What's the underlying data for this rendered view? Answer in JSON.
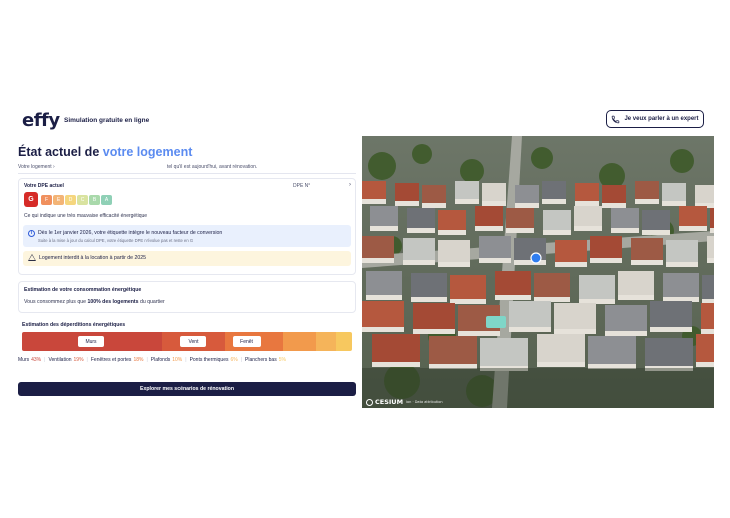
{
  "header": {
    "logo": "effy",
    "tagline": "Simulation gratuite en ligne",
    "expert_button": "Je veux parler à un expert"
  },
  "page": {
    "title_prefix": "État actuel de",
    "title_accent": "votre logement",
    "subtitle_left": "Votre logement ›",
    "subtitle_right": "tel qu'il est aujourd'hui, avant rénovation."
  },
  "dpe": {
    "label": "Votre DPE actuel",
    "dpe_no": "DPE N°",
    "chevron": "›",
    "letters": [
      {
        "letter": "G",
        "color": "#d62b27",
        "active": true
      },
      {
        "letter": "F",
        "color": "#f0905e"
      },
      {
        "letter": "E",
        "color": "#f3b476"
      },
      {
        "letter": "D",
        "color": "#f5d67e"
      },
      {
        "letter": "C",
        "color": "#d9e3a0"
      },
      {
        "letter": "B",
        "color": "#a9d9ab"
      },
      {
        "letter": "A",
        "color": "#8fd0b6"
      }
    ],
    "description": "Ce qui indique une très mauvaise efficacité énergétique",
    "info_title": "Dès le 1er janvier 2026, votre étiquette intègre le nouveau facteur de conversion",
    "info_text": "Suite à la mise à jour du calcul DPE, votre étiquette DPE n'évolue pas et reste en G",
    "info_icon": "info-icon",
    "warning_text": "Logement interdit à la location à partir de 2025",
    "warning_icon": "warning-icon"
  },
  "conso": {
    "label": "Estimation de votre consommation énergétique",
    "text_before": "Vous consommez plus que",
    "text_bold": "100% des logements",
    "text_after": "du quartier"
  },
  "deperditions": {
    "label": "Estimation des déperditions énergétiques",
    "segments": [
      {
        "name": "Murs",
        "percent": 43,
        "color": "#c9473b",
        "tag": "Murs"
      },
      {
        "name": "Ventilation",
        "percent": 19,
        "color": "#d75a3c",
        "tag": "Vent"
      },
      {
        "name": "Fenêtres et portes",
        "percent": 18,
        "color": "#e8773f",
        "tag": "Fenêt"
      },
      {
        "name": "Plafonds",
        "percent": 10,
        "color": "#f29a4c",
        "tag": ""
      },
      {
        "name": "Ponts thermiques",
        "percent": 6,
        "color": "#f5b45a",
        "tag": ""
      },
      {
        "name": "Planchers bas",
        "percent": 5,
        "color": "#f7c85f",
        "tag": ""
      }
    ],
    "legend": [
      {
        "label": "Murs",
        "pct": "43%",
        "pct_color": "#c9473b"
      },
      {
        "label": "Ventilation",
        "pct": "19%",
        "pct_color": "#d75a3c"
      },
      {
        "label": "Fenêtres et portes",
        "pct": "18%",
        "pct_color": "#e8773f"
      },
      {
        "label": "Plafonds",
        "pct": "10%",
        "pct_color": "#f29a4c"
      },
      {
        "label": "Ponts thermiques",
        "pct": "6%",
        "pct_color": "#f5b45a"
      },
      {
        "label": "Planchers bas",
        "pct": "5%",
        "pct_color": "#f7c85f"
      }
    ]
  },
  "cta": {
    "label": "Explorer mes scénarios de rénovation"
  },
  "map": {
    "attribution": "CESIUM",
    "attribution_small": "ion · Data attribution"
  }
}
